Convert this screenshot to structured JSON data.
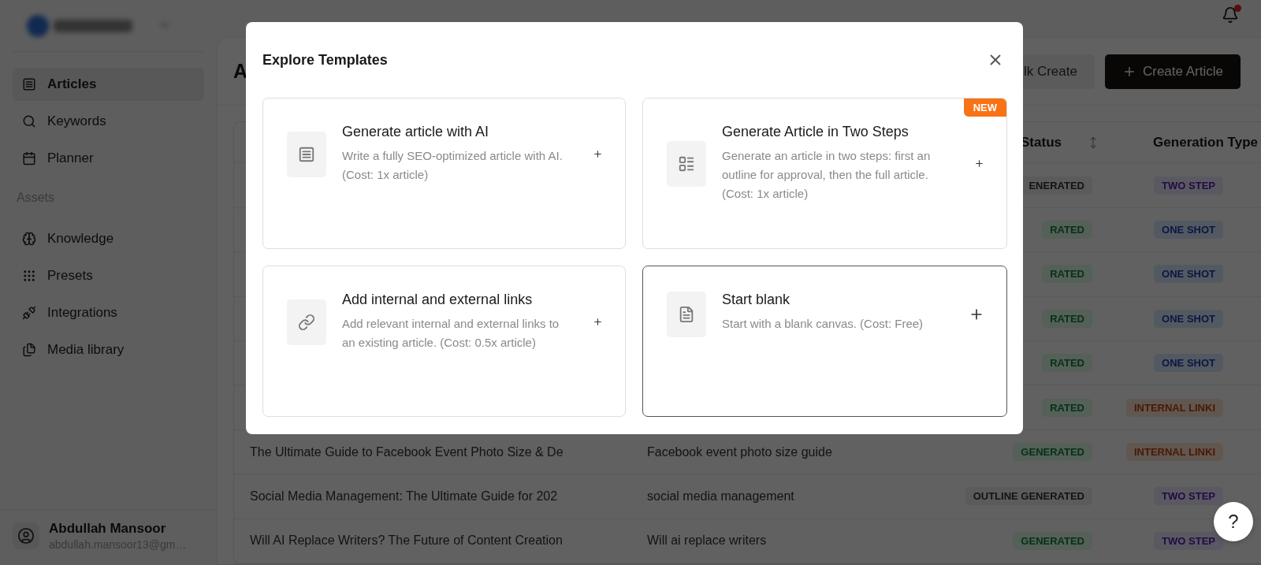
{
  "sidebar": {
    "items": [
      {
        "label": "Articles",
        "selected": true
      },
      {
        "label": "Keywords",
        "selected": false
      },
      {
        "label": "Planner",
        "selected": false
      }
    ],
    "section_label": "Assets",
    "asset_items": [
      {
        "label": "Knowledge",
        "selected": false
      },
      {
        "label": "Presets",
        "selected": false
      },
      {
        "label": "Integrations",
        "selected": false
      },
      {
        "label": "Media library",
        "selected": false
      }
    ],
    "user": {
      "name": "Abdullah Mansoor",
      "email": "abdullah.mansoor13@gm…"
    }
  },
  "topbar": {
    "notification_unread": true
  },
  "header": {
    "title": "A",
    "buttons": [
      {
        "label": "lk Create",
        "kind": "secondary"
      },
      {
        "label": "Create Article",
        "kind": "primary"
      }
    ]
  },
  "table": {
    "columns": [
      "Status",
      "Generation Type"
    ],
    "rows": [
      {
        "status": {
          "text": "ENERATED",
          "kind": "outline"
        },
        "generation_type": {
          "text": "TWO STEP",
          "kind": "two_step"
        }
      },
      {
        "status": {
          "text": "RATED",
          "kind": "generated"
        },
        "generation_type": {
          "text": "ONE SHOT",
          "kind": "one_shot"
        }
      },
      {
        "status": {
          "text": "RATED",
          "kind": "generated"
        },
        "generation_type": {
          "text": "ONE SHOT",
          "kind": "one_shot"
        }
      },
      {
        "status": {
          "text": "RATED",
          "kind": "generated"
        },
        "generation_type": {
          "text": "ONE SHOT",
          "kind": "one_shot"
        }
      },
      {
        "status": {
          "text": "RATED",
          "kind": "generated"
        },
        "generation_type": {
          "text": "ONE SHOT",
          "kind": "one_shot"
        }
      },
      {
        "status": {
          "text": "RATED",
          "kind": "generated"
        },
        "generation_type": {
          "text": "INTERNAL LINKI",
          "kind": "internal_linking"
        }
      },
      {
        "title": "The Ultimate Guide to Facebook Event Photo Size & De",
        "keyword": "Facebook event photo size guide",
        "status": {
          "text": "GENERATED",
          "kind": "generated"
        },
        "generation_type": {
          "text": "INTERNAL LINKI",
          "kind": "internal_linking"
        }
      },
      {
        "title": "Social Media Management: The Ultimate Guide for 202",
        "keyword": "social media management",
        "status": {
          "text": "OUTLINE GENERATED",
          "kind": "outline"
        },
        "generation_type": {
          "text": "TWO STEP",
          "kind": "two_step"
        }
      },
      {
        "title": "Will AI Replace Writers? The Future of Content Creation",
        "keyword": "Will ai replace writers",
        "status": {
          "text": "GENERATED",
          "kind": "generated"
        },
        "generation_type": {
          "text": "TWO STEP",
          "kind": "two_step"
        }
      }
    ]
  },
  "modal": {
    "title": "Explore Templates",
    "new_label": "NEW",
    "cards": [
      {
        "title": "Generate article with AI",
        "description": "Write a fully SEO-optimized article with AI. (Cost: 1x article)",
        "selected": false,
        "is_new": false
      },
      {
        "title": "Generate Article in Two Steps",
        "description": "Generate an article in two steps: first an outline for approval, then the full article. (Cost: 1x article)",
        "selected": false,
        "is_new": true
      },
      {
        "title": "Add internal and external links",
        "description": "Add relevant internal and external links to an existing article. (Cost: 0.5x article)",
        "selected": false,
        "is_new": false
      },
      {
        "title": "Start blank",
        "description": "Start with a blank canvas. (Cost: Free)",
        "selected": true,
        "is_new": false
      }
    ]
  },
  "help_button": "?"
}
